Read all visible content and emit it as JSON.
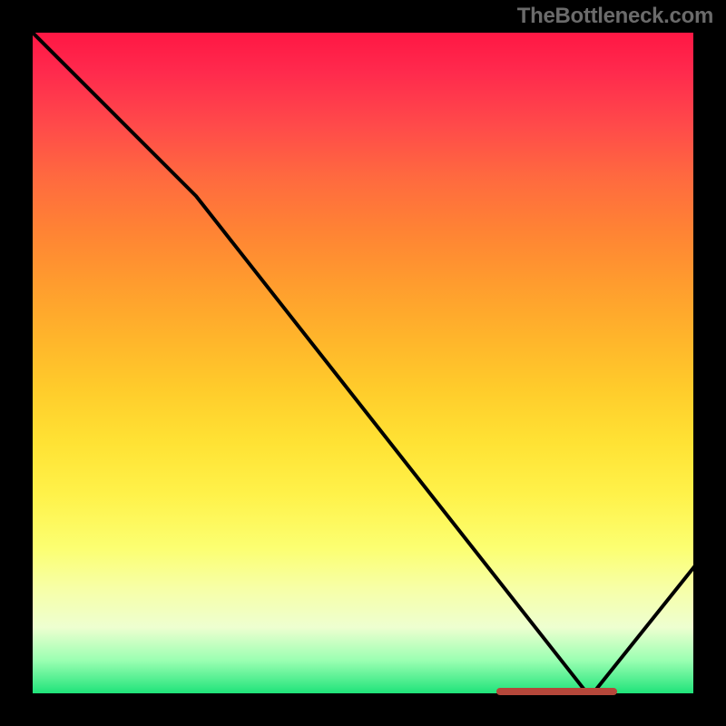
{
  "watermark": "TheBottleneck.com",
  "chart_data": {
    "type": "line",
    "title": "",
    "xlabel": "",
    "ylabel": "",
    "xlim": [
      0,
      100
    ],
    "ylim": [
      0,
      100
    ],
    "x": [
      0,
      25,
      84,
      100
    ],
    "y": [
      100,
      75,
      0,
      20
    ],
    "gradient_stops": [
      {
        "pos": 0,
        "color": "#ff1744"
      },
      {
        "pos": 50,
        "color": "#ffcc2b"
      },
      {
        "pos": 80,
        "color": "#fcff71"
      },
      {
        "pos": 100,
        "color": "#1fe37a"
      }
    ],
    "bottom_marker": {
      "x_start": 70,
      "x_end": 88,
      "color": "#b5473a"
    }
  },
  "colors": {
    "background": "#000000",
    "line": "#000000",
    "watermark": "#6b6b6b"
  }
}
